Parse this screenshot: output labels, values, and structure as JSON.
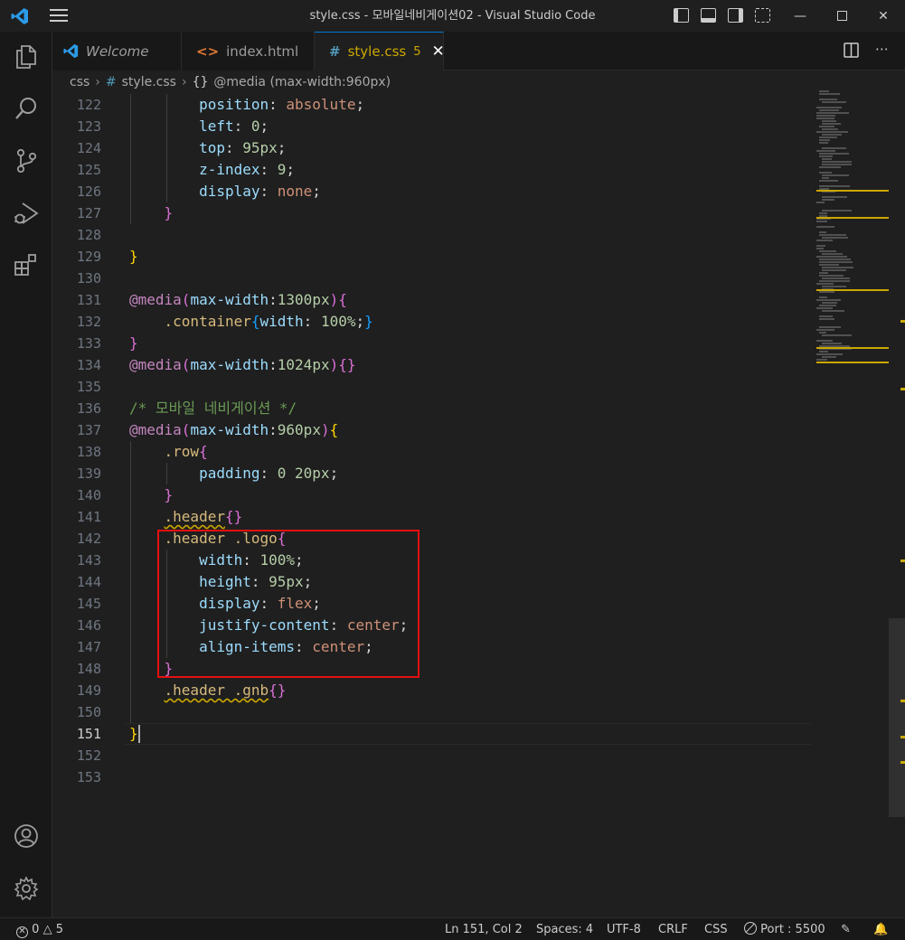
{
  "window": {
    "title": "style.css - 모바일네비게이션02 - Visual Studio Code"
  },
  "tabs": [
    {
      "label": "Welcome",
      "icon": "vscode-icon"
    },
    {
      "label": "index.html",
      "icon": "html-icon"
    },
    {
      "label": "style.css",
      "icon": "css-hash-icon",
      "badge": "5",
      "active": true
    }
  ],
  "breadcrumb": {
    "folder": "css",
    "file": "style.css",
    "symbol": "@media (max-width:960px)"
  },
  "editor": {
    "lines": [
      {
        "n": "122",
        "tokens": [
          [
            "        ",
            ""
          ],
          [
            "position",
            "k-prop"
          ],
          [
            ": ",
            "k-punc"
          ],
          [
            "absolute",
            "k-val"
          ],
          [
            ";",
            "k-punc"
          ]
        ]
      },
      {
        "n": "123",
        "tokens": [
          [
            "        ",
            ""
          ],
          [
            "left",
            "k-prop"
          ],
          [
            ": ",
            "k-punc"
          ],
          [
            "0",
            "k-num"
          ],
          [
            ";",
            "k-punc"
          ]
        ]
      },
      {
        "n": "124",
        "tokens": [
          [
            "        ",
            ""
          ],
          [
            "top",
            "k-prop"
          ],
          [
            ": ",
            "k-punc"
          ],
          [
            "95px",
            "k-num"
          ],
          [
            ";",
            "k-punc"
          ]
        ]
      },
      {
        "n": "125",
        "tokens": [
          [
            "        ",
            ""
          ],
          [
            "z-index",
            "k-prop"
          ],
          [
            ": ",
            "k-punc"
          ],
          [
            "9",
            "k-num"
          ],
          [
            ";",
            "k-punc"
          ]
        ]
      },
      {
        "n": "126",
        "tokens": [
          [
            "        ",
            ""
          ],
          [
            "display",
            "k-prop"
          ],
          [
            ": ",
            "k-punc"
          ],
          [
            "none",
            "k-val"
          ],
          [
            ";",
            "k-punc"
          ]
        ]
      },
      {
        "n": "127",
        "tokens": [
          [
            "    ",
            ""
          ],
          [
            "}",
            "br2"
          ]
        ]
      },
      {
        "n": "128",
        "tokens": []
      },
      {
        "n": "129",
        "tokens": [
          [
            "}",
            "br1"
          ]
        ]
      },
      {
        "n": "130",
        "tokens": []
      },
      {
        "n": "131",
        "tokens": [
          [
            "@media",
            "k-at"
          ],
          [
            "(",
            "br2"
          ],
          [
            "max-width",
            "k-prop"
          ],
          [
            ":",
            "k-punc"
          ],
          [
            "1300px",
            "k-num"
          ],
          [
            ")",
            "br2"
          ],
          [
            "{",
            "br2"
          ]
        ]
      },
      {
        "n": "132",
        "tokens": [
          [
            "    ",
            ""
          ],
          [
            ".container",
            "k-sel"
          ],
          [
            "{",
            "br3"
          ],
          [
            "width",
            "k-prop"
          ],
          [
            ": ",
            "k-punc"
          ],
          [
            "100%",
            "k-num"
          ],
          [
            ";",
            "k-punc"
          ],
          [
            "}",
            "br3"
          ]
        ]
      },
      {
        "n": "133",
        "tokens": [
          [
            "}",
            "br2"
          ]
        ]
      },
      {
        "n": "134",
        "tokens": [
          [
            "@media",
            "k-at"
          ],
          [
            "(",
            "br2"
          ],
          [
            "max-width",
            "k-prop"
          ],
          [
            ":",
            "k-punc"
          ],
          [
            "1024px",
            "k-num"
          ],
          [
            ")",
            "br2"
          ],
          [
            "{}",
            "br2"
          ]
        ]
      },
      {
        "n": "135",
        "tokens": []
      },
      {
        "n": "136",
        "tokens": [
          [
            "/* 모바일 네비게이션 */",
            "k-com"
          ]
        ]
      },
      {
        "n": "137",
        "tokens": [
          [
            "@media",
            "k-at"
          ],
          [
            "(",
            "br2"
          ],
          [
            "max-width",
            "k-prop"
          ],
          [
            ":",
            "k-punc"
          ],
          [
            "960px",
            "k-num"
          ],
          [
            ")",
            "br2"
          ],
          [
            "{",
            "br1"
          ]
        ]
      },
      {
        "n": "138",
        "tokens": [
          [
            "    ",
            ""
          ],
          [
            ".row",
            "k-sel"
          ],
          [
            "{",
            "br2"
          ]
        ]
      },
      {
        "n": "139",
        "tokens": [
          [
            "        ",
            ""
          ],
          [
            "padding",
            "k-prop"
          ],
          [
            ": ",
            "k-punc"
          ],
          [
            "0 20px",
            "k-num"
          ],
          [
            ";",
            "k-punc"
          ]
        ]
      },
      {
        "n": "140",
        "tokens": [
          [
            "    ",
            ""
          ],
          [
            "}",
            "br2"
          ]
        ]
      },
      {
        "n": "141",
        "tokens": [
          [
            "    ",
            ""
          ],
          [
            ".header",
            "k-sel squig"
          ],
          [
            "{}",
            "br2"
          ]
        ]
      },
      {
        "n": "142",
        "tokens": [
          [
            "    ",
            ""
          ],
          [
            ".header .logo",
            "k-sel"
          ],
          [
            "{",
            "br2"
          ]
        ]
      },
      {
        "n": "143",
        "tokens": [
          [
            "        ",
            ""
          ],
          [
            "width",
            "k-prop"
          ],
          [
            ": ",
            "k-punc"
          ],
          [
            "100%",
            "k-num"
          ],
          [
            ";",
            "k-punc"
          ]
        ]
      },
      {
        "n": "144",
        "tokens": [
          [
            "        ",
            ""
          ],
          [
            "height",
            "k-prop"
          ],
          [
            ": ",
            "k-punc"
          ],
          [
            "95px",
            "k-num"
          ],
          [
            ";",
            "k-punc"
          ]
        ]
      },
      {
        "n": "145",
        "tokens": [
          [
            "        ",
            ""
          ],
          [
            "display",
            "k-prop"
          ],
          [
            ": ",
            "k-punc"
          ],
          [
            "flex",
            "k-val"
          ],
          [
            ";",
            "k-punc"
          ]
        ]
      },
      {
        "n": "146",
        "tokens": [
          [
            "        ",
            ""
          ],
          [
            "justify-content",
            "k-prop"
          ],
          [
            ": ",
            "k-punc"
          ],
          [
            "center",
            "k-val"
          ],
          [
            ";",
            "k-punc"
          ]
        ]
      },
      {
        "n": "147",
        "tokens": [
          [
            "        ",
            ""
          ],
          [
            "align-items",
            "k-prop"
          ],
          [
            ": ",
            "k-punc"
          ],
          [
            "center",
            "k-val"
          ],
          [
            ";",
            "k-punc"
          ]
        ]
      },
      {
        "n": "148",
        "tokens": [
          [
            "    ",
            ""
          ],
          [
            "}",
            "br2"
          ]
        ]
      },
      {
        "n": "149",
        "tokens": [
          [
            "    ",
            ""
          ],
          [
            ".header .gnb",
            "k-sel squig"
          ],
          [
            "{}",
            "br2"
          ]
        ]
      },
      {
        "n": "150",
        "tokens": []
      },
      {
        "n": "151",
        "tokens": [
          [
            "}",
            "br1"
          ]
        ],
        "current": true
      },
      {
        "n": "152",
        "tokens": []
      },
      {
        "n": "153",
        "tokens": []
      }
    ]
  },
  "statusbar": {
    "errors": "0",
    "warnings": "5",
    "position": "Ln 151, Col 2",
    "spaces": "Spaces: 4",
    "encoding": "UTF-8",
    "eol": "CRLF",
    "language": "CSS",
    "port": "Port : 5500"
  },
  "colors": {
    "accent": "#0078d4",
    "warning": "#cca700",
    "highlight_box": "#e31010"
  }
}
